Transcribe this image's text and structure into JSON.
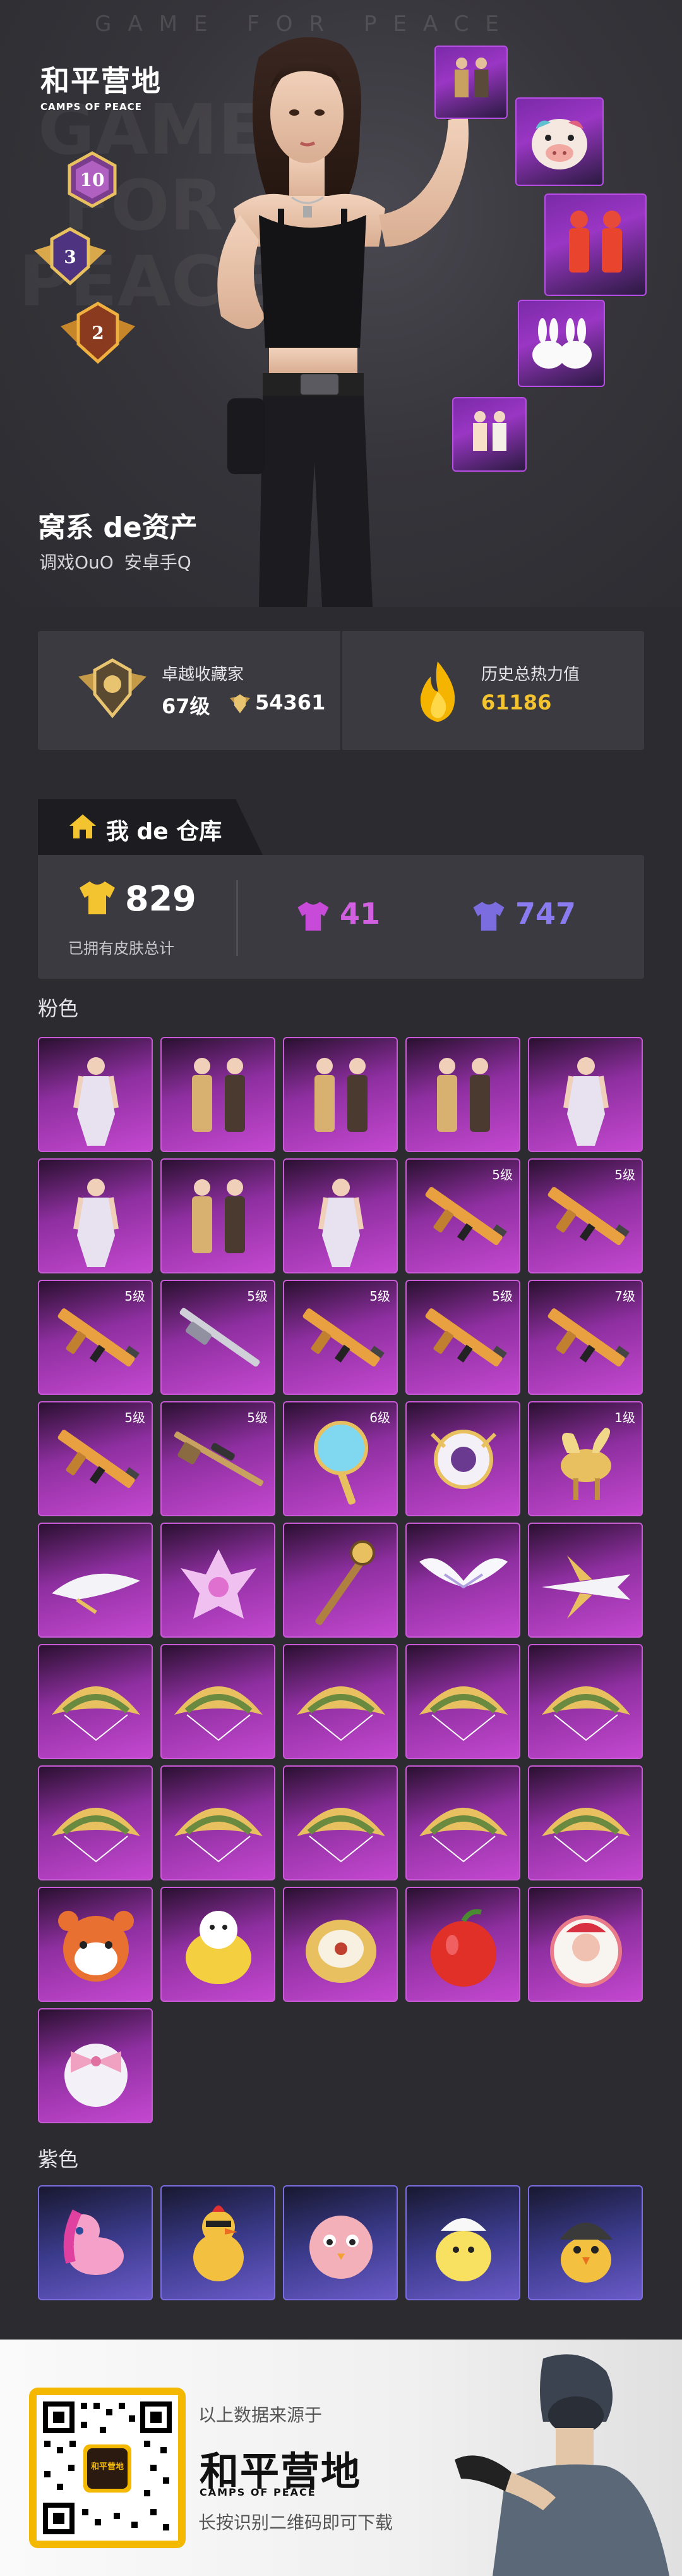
{
  "hero": {
    "watermark": "GAME FOR PEACE",
    "bg_words": [
      "GAME",
      "FOR",
      "PEACE"
    ],
    "logo_cn": "和平营地",
    "logo_en": "CAMPS OF PEACE",
    "ranks": [
      "10",
      "3",
      "2"
    ],
    "player_name": "窝系 de资产",
    "player_sub": "调戏OuO  安卓手Q"
  },
  "stats": {
    "collector_label": "卓越收藏家",
    "collector_level": "67级",
    "collector_points": "54361",
    "heat_label": "历史总热力值",
    "heat_value": "61186"
  },
  "warehouse": {
    "tab_label": "我 de 仓库",
    "total_value": "829",
    "total_label": "已拥有皮肤总计",
    "pink_count": "41",
    "purple_count": "747",
    "colors": {
      "gold": "#f4c430",
      "pink": "#c84ad8",
      "purple": "#7b6ce0"
    }
  },
  "sections": {
    "pink_title": "粉色",
    "purple_title": "紫色"
  },
  "pink_items": [
    {
      "icon": "outfit-icon",
      "level": ""
    },
    {
      "icon": "outfit-pair-icon",
      "level": ""
    },
    {
      "icon": "outfit-pair-icon",
      "level": ""
    },
    {
      "icon": "outfit-pair-icon",
      "level": ""
    },
    {
      "icon": "outfit-icon",
      "level": ""
    },
    {
      "icon": "outfit-icon",
      "level": ""
    },
    {
      "icon": "outfit-pair-icon",
      "level": ""
    },
    {
      "icon": "outfit-icon",
      "level": ""
    },
    {
      "icon": "rifle-icon",
      "level": "5级"
    },
    {
      "icon": "rifle-icon",
      "level": "5级"
    },
    {
      "icon": "rifle-icon",
      "level": "5级"
    },
    {
      "icon": "shotgun-icon",
      "level": "5级"
    },
    {
      "icon": "rifle-icon",
      "level": "5级"
    },
    {
      "icon": "rifle-icon",
      "level": "5级"
    },
    {
      "icon": "rifle-icon",
      "level": "7级"
    },
    {
      "icon": "rifle-icon",
      "level": "5级"
    },
    {
      "icon": "sniper-icon",
      "level": "5级"
    },
    {
      "icon": "mirror-icon",
      "level": "6级"
    },
    {
      "icon": "emblem-icon",
      "level": ""
    },
    {
      "icon": "pegasus-icon",
      "level": "1级"
    },
    {
      "icon": "glider-icon",
      "level": ""
    },
    {
      "icon": "flower-icon",
      "level": ""
    },
    {
      "icon": "staff-icon",
      "level": ""
    },
    {
      "icon": "wings-icon",
      "level": ""
    },
    {
      "icon": "plane-icon",
      "level": ""
    },
    {
      "icon": "parachute-icon",
      "level": ""
    },
    {
      "icon": "parachute-icon",
      "level": ""
    },
    {
      "icon": "parachute-icon",
      "level": ""
    },
    {
      "icon": "parachute-icon",
      "level": ""
    },
    {
      "icon": "parachute-icon",
      "level": ""
    },
    {
      "icon": "parachute-icon",
      "level": ""
    },
    {
      "icon": "parachute-icon",
      "level": ""
    },
    {
      "icon": "parachute-icon",
      "level": ""
    },
    {
      "icon": "parachute-icon",
      "level": ""
    },
    {
      "icon": "parachute-icon",
      "level": ""
    },
    {
      "icon": "panda-backpack-icon",
      "level": ""
    },
    {
      "icon": "chick-backpack-icon",
      "level": ""
    },
    {
      "icon": "pie-backpack-icon",
      "level": ""
    },
    {
      "icon": "apple-backpack-icon",
      "level": ""
    },
    {
      "icon": "santa-backpack-icon",
      "level": ""
    },
    {
      "icon": "bow-backpack-icon",
      "level": ""
    }
  ],
  "purple_items": [
    {
      "icon": "pony-icon",
      "level": ""
    },
    {
      "icon": "chicken-icon",
      "level": ""
    },
    {
      "icon": "bird-icon",
      "level": ""
    },
    {
      "icon": "chick-icon",
      "level": ""
    },
    {
      "icon": "chicken-helmet-icon",
      "level": ""
    }
  ],
  "footer": {
    "source_text": "以上数据来源于",
    "brand_cn": "和平营地",
    "brand_en": "CAMPS OF PEACE",
    "qr_logo": "和平营地",
    "download_text": "长按识别二维码即可下载"
  }
}
